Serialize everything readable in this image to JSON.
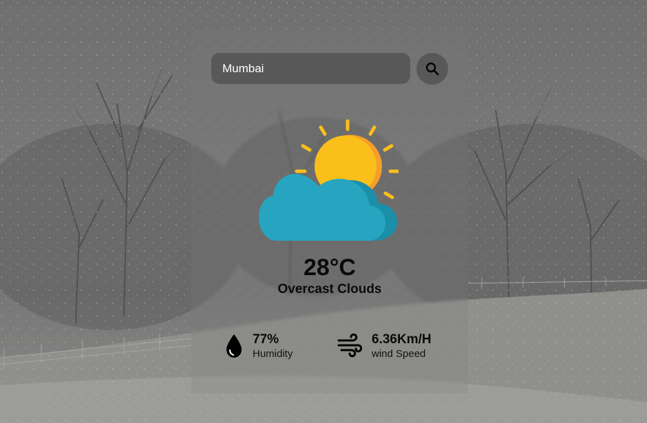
{
  "search": {
    "value": "Mumbai",
    "button_icon": "search-icon"
  },
  "weather": {
    "icon": "partly-cloudy-icon",
    "temperature": "28°C",
    "description": "Overcast Clouds"
  },
  "humidity": {
    "icon": "water-drop-icon",
    "value": "77%",
    "label": "Humidity"
  },
  "wind": {
    "icon": "wind-icon",
    "value": "6.36Km/H",
    "label": "wind Speed"
  },
  "colors": {
    "sun": "#FBBF1B",
    "sun_shade": "#F59E2B",
    "cloud": "#27A5C0",
    "cloud_shade": "#1B8FA9",
    "input_bg": "#585858"
  }
}
